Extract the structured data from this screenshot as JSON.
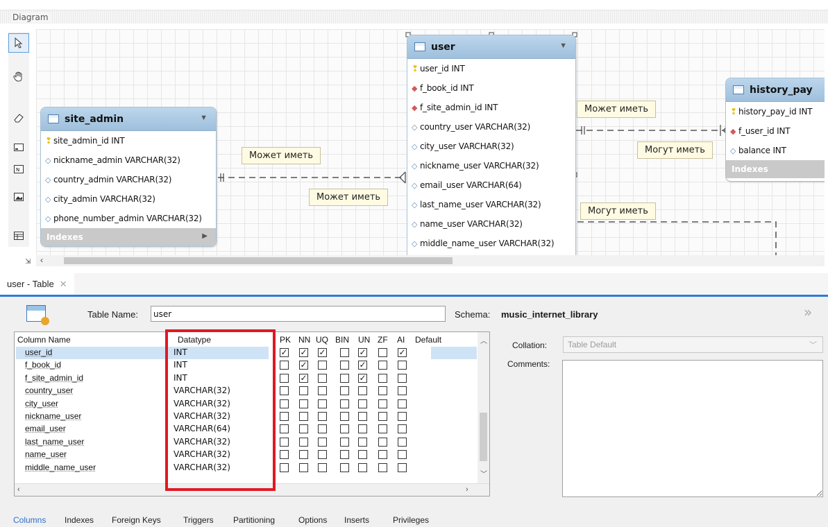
{
  "diagram": {
    "title": "Diagram",
    "toolbar": [
      "pointer-icon",
      "hand-icon",
      "eraser-icon",
      "layer-icon",
      "note-icon",
      "image-icon",
      "table-icon"
    ],
    "entities": {
      "site_admin": {
        "name": "site_admin",
        "columns": [
          {
            "key": "pk",
            "label": "site_admin_id INT"
          },
          {
            "key": "col",
            "label": "nickname_admin VARCHAR(32)"
          },
          {
            "key": "col",
            "label": "country_admin VARCHAR(32)"
          },
          {
            "key": "col",
            "label": "city_admin VARCHAR(32)"
          },
          {
            "key": "col",
            "label": "phone_number_admin VARCHAR(32)"
          }
        ],
        "indexes_label": "Indexes"
      },
      "user": {
        "name": "user",
        "columns": [
          {
            "key": "pk",
            "label": "user_id INT"
          },
          {
            "key": "fk",
            "label": "f_book_id INT"
          },
          {
            "key": "fk",
            "label": "f_site_admin_id INT"
          },
          {
            "key": "col",
            "label": "country_user VARCHAR(32)"
          },
          {
            "key": "col",
            "label": "city_user VARCHAR(32)"
          },
          {
            "key": "col",
            "label": "nickname_user VARCHAR(32)"
          },
          {
            "key": "col",
            "label": "email_user VARCHAR(64)"
          },
          {
            "key": "col",
            "label": "last_name_user VARCHAR(32)"
          },
          {
            "key": "col",
            "label": "name_user VARCHAR(32)"
          },
          {
            "key": "col",
            "label": "middle_name_user VARCHAR(32)"
          }
        ]
      },
      "history_pay": {
        "name": "history_pay",
        "columns": [
          {
            "key": "pk",
            "label": "history_pay_id INT"
          },
          {
            "key": "fk",
            "label": "f_user_id INT"
          },
          {
            "key": "col",
            "label": "balance INT"
          }
        ],
        "indexes_label": "Indexes"
      }
    },
    "relation_labels": {
      "may_have_1": "Может иметь",
      "may_have_2": "Может иметь",
      "may_have_3": "Может иметь",
      "can_have_1": "Могут иметь",
      "can_have_2": "Могут иметь"
    }
  },
  "editor": {
    "tab_label": "user - Table",
    "table_name_label": "Table Name:",
    "table_name_value": "user",
    "schema_label": "Schema:",
    "schema_value": "music_internet_library",
    "collation_label": "Collation:",
    "collation_value": "Table Default",
    "comments_label": "Comments:",
    "columns_header": {
      "name": "Column Name",
      "datatype": "Datatype",
      "flags": [
        "PK",
        "NN",
        "UQ",
        "BIN",
        "UN",
        "ZF",
        "AI"
      ],
      "default": "Default"
    },
    "columns": [
      {
        "name": "user_id",
        "datatype": "INT",
        "flags": [
          true,
          true,
          true,
          false,
          true,
          false,
          true
        ]
      },
      {
        "name": "f_book_id",
        "datatype": "INT",
        "flags": [
          false,
          true,
          false,
          false,
          true,
          false,
          false
        ]
      },
      {
        "name": "f_site_admin_id",
        "datatype": "INT",
        "flags": [
          false,
          true,
          false,
          false,
          true,
          false,
          false
        ]
      },
      {
        "name": "country_user",
        "datatype": "VARCHAR(32)",
        "flags": [
          false,
          false,
          false,
          false,
          false,
          false,
          false
        ]
      },
      {
        "name": "city_user",
        "datatype": "VARCHAR(32)",
        "flags": [
          false,
          false,
          false,
          false,
          false,
          false,
          false
        ]
      },
      {
        "name": "nickname_user",
        "datatype": "VARCHAR(32)",
        "flags": [
          false,
          false,
          false,
          false,
          false,
          false,
          false
        ]
      },
      {
        "name": "email_user",
        "datatype": "VARCHAR(64)",
        "flags": [
          false,
          false,
          false,
          false,
          false,
          false,
          false
        ]
      },
      {
        "name": "last_name_user",
        "datatype": "VARCHAR(32)",
        "flags": [
          false,
          false,
          false,
          false,
          false,
          false,
          false
        ]
      },
      {
        "name": "name_user",
        "datatype": "VARCHAR(32)",
        "flags": [
          false,
          false,
          false,
          false,
          false,
          false,
          false
        ]
      },
      {
        "name": "middle_name_user",
        "datatype": "VARCHAR(32)",
        "flags": [
          false,
          false,
          false,
          false,
          false,
          false,
          false
        ]
      }
    ],
    "bottom_tabs": [
      "Columns",
      "Indexes",
      "Foreign Keys",
      "Triggers",
      "Partitioning",
      "Options",
      "Inserts",
      "Privileges"
    ],
    "active_bottom_tab": "Columns"
  },
  "colors": {
    "accent": "#2d7bd6",
    "highlight": "#e01922",
    "entity_header": "#9fbfdc",
    "relation_label_bg": "#fffbe3"
  }
}
